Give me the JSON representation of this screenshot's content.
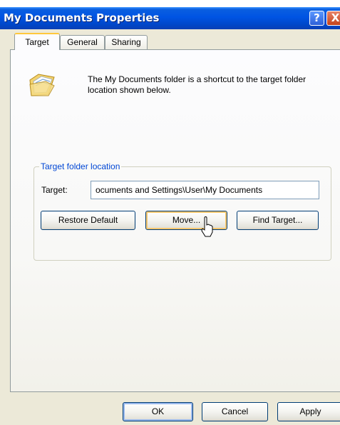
{
  "window": {
    "title": "My Documents Properties",
    "help_glyph": "?",
    "close_glyph": "X"
  },
  "tabs": [
    {
      "label": "Target",
      "selected": true
    },
    {
      "label": "General",
      "selected": false
    },
    {
      "label": "Sharing",
      "selected": false
    }
  ],
  "target_tab": {
    "icon": "folder-icon",
    "description": "The My Documents folder is a shortcut to the target folder location shown below.",
    "group_label": "Target folder location",
    "target_label": "Target:",
    "target_value": "ocuments and Settings\\User\\My Documents",
    "buttons": {
      "restore": "Restore Default",
      "move": "Move...",
      "find": "Find Target..."
    }
  },
  "footer": {
    "ok": "OK",
    "cancel": "Cancel",
    "apply": "Apply"
  },
  "colors": {
    "titlebar": "#0054e3",
    "group_label": "#0046d5",
    "tab_highlight": "#ffc83c"
  }
}
